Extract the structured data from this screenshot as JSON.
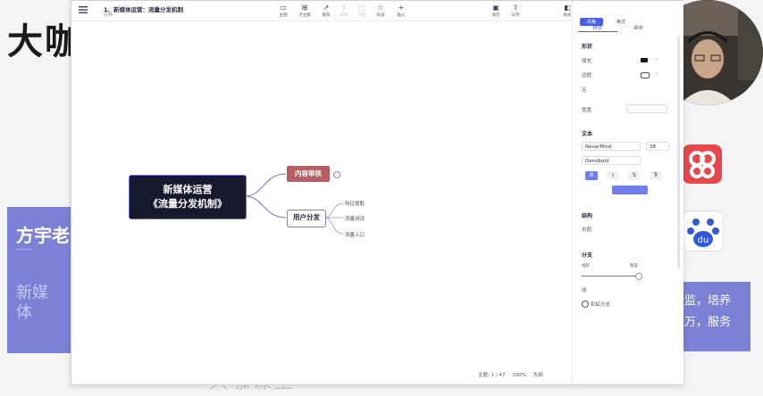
{
  "background": {
    "brand": "大咖",
    "left_card_name": "方宇老",
    "left_card_desc_line1": "新媒",
    "left_card_desc_line2": "体",
    "right_card_line1": "监，培养",
    "right_card_line2": "万，服务",
    "watermark": "大咖课堂",
    "colors": {
      "card": "#7b82d6",
      "bilibili": "#e8474c",
      "baidu_paw": "#3259d8"
    }
  },
  "app": {
    "title": "1、新媒体运营：流量分发机制",
    "subtitle": "思维",
    "toolbar": [
      {
        "icon": "topic-icon",
        "glyph": "▭",
        "label": "主题"
      },
      {
        "icon": "subtopic-icon",
        "glyph": "⊞",
        "label": "子主题"
      },
      {
        "icon": "relation-icon",
        "glyph": "↗",
        "label": "联系"
      },
      {
        "icon": "summary-icon",
        "glyph": "}",
        "label": "概要"
      },
      {
        "icon": "boundary-icon",
        "glyph": "▢",
        "label": "外框"
      },
      {
        "icon": "marker-icon",
        "glyph": "☆",
        "label": "标记"
      },
      {
        "icon": "insert-icon",
        "glyph": "+",
        "label": "插入"
      },
      {
        "icon": "presentation-icon",
        "glyph": "▣",
        "label": "演示"
      },
      {
        "icon": "share-icon",
        "glyph": "⇪",
        "label": "分享"
      },
      {
        "icon": "format-icon",
        "glyph": "◧",
        "label": "格式"
      }
    ],
    "mindmap": {
      "root_line1": "新媒体运营",
      "root_line2": "《流量分发机制》",
      "branch1": "内容审核",
      "branch2": "用户分发",
      "leaves": [
        "特征提取",
        "流量测试",
        "流量入口"
      ]
    },
    "status": {
      "topics": "主题: 1 / 47",
      "zoom": "100%",
      "zoom_label": "大纲"
    }
  },
  "panel": {
    "top_tabs": [
      "风格",
      "格式"
    ],
    "sub_tabs": [
      "样式",
      "画布"
    ],
    "section_shape": "形状",
    "fill_label": "填充",
    "border_label": "边框",
    "none_label": "无",
    "width_label": "宽度",
    "section_text": "文本",
    "font_name": "NeverMind",
    "font_size": "28",
    "font_weight": "Demibold",
    "format_buttons": [
      "B",
      "I",
      "S",
      "Tr"
    ],
    "section_structure": "结构",
    "structure_value": "右图",
    "section_branch": "分支",
    "branch_sublabels": [
      "线形",
      "粗度"
    ],
    "line_label": "线",
    "rainbow_label": "彩虹分支",
    "accent_color": "#4a5fe8"
  }
}
